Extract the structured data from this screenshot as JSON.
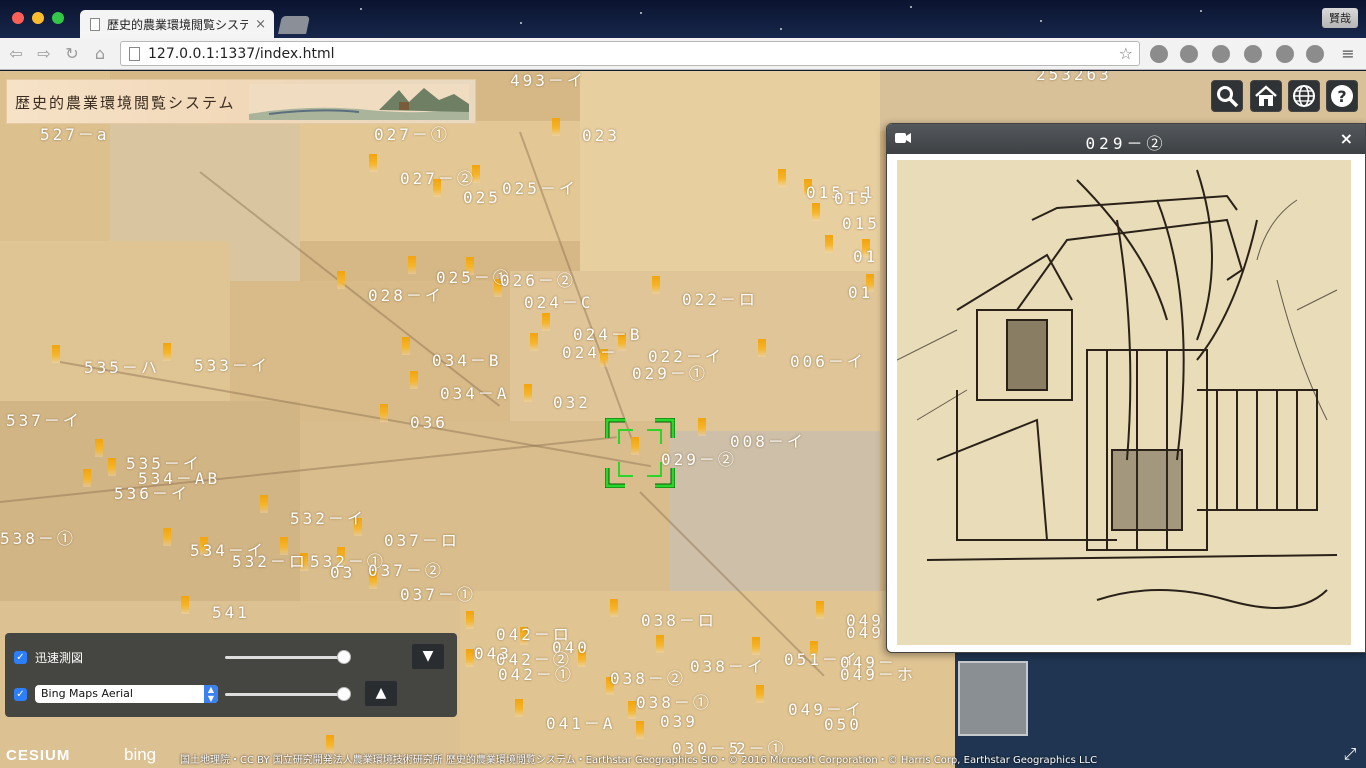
{
  "browser": {
    "tab_title": "歴史的農業環境閲覧システム",
    "tab_close": "×",
    "profile_label": "賢哉",
    "url": "127.0.0.1:1337/index.html",
    "nav_icons": [
      "back-icon",
      "forward-icon",
      "reload-icon",
      "home-icon"
    ]
  },
  "app": {
    "title": "歴史的農業環境閲覧システム",
    "toolbar_icons": [
      "search-icon",
      "home-icon",
      "globe-icon",
      "help-icon"
    ]
  },
  "map_labels": [
    "493－イ",
    "527－a",
    "027－①",
    "023",
    "027－②",
    "025－イ",
    "025",
    "015－1",
    "015",
    "015",
    "01",
    "01",
    "025－①",
    "026－②",
    "024－C",
    "028－イ",
    "022－ロ",
    "024－B",
    "024－",
    "022－イ",
    "006－イ",
    "535－ハ",
    "533－イ",
    "034－B",
    "029－①",
    "034－A",
    "032",
    "537－イ",
    "036",
    "008－イ",
    "535－イ",
    "534－AB",
    "536－イ",
    "029－②",
    "532－イ",
    "538－①",
    "037－ロ",
    "534－イ",
    "532－ロ",
    "532－①",
    "037－②",
    "03",
    "037－①",
    "541",
    "038－ロ",
    "049",
    "049",
    "042－ロ",
    "040",
    "042－②",
    "043",
    "042－①",
    "051－イ",
    "049－",
    "038－②",
    "038－イ",
    "049－ホ",
    "038－①",
    "049－イ",
    "041－A",
    "039",
    "050",
    "030－5",
    "2－①",
    "253263"
  ],
  "infobox": {
    "title": "029－②",
    "close": "×",
    "image_description_icon": "sketch-image"
  },
  "layers": [
    {
      "label": "迅速測図",
      "checked": true,
      "opacity": 0.97,
      "button": "▼"
    },
    {
      "label": "Bing Maps Aerial",
      "checked": true,
      "opacity": 0.97,
      "button": "▲"
    }
  ],
  "credits": {
    "cesium": "CESIUM",
    "bing": "bing",
    "text": "国土地理院・CC BY 国立研究開発法人農業環境技術研究所 歴史的農業環境閲覧システム・Earthstar Geographics SIO・© 2016 Microsoft Corporation・© Harris Corp, Earthstar Geographics LLC"
  },
  "colors": {
    "accent_pin": "#f1a40e",
    "reticle": "#00c000",
    "panel_bg": "#303336",
    "checkbox": "#2d7ff9"
  }
}
